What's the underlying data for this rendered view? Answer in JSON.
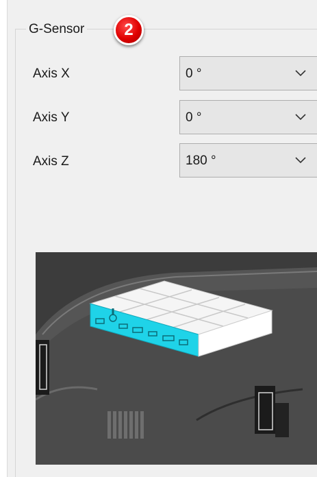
{
  "group": {
    "title": "G-Sensor",
    "badge": "2"
  },
  "axes": [
    {
      "label": "Axis X",
      "value": "0 °"
    },
    {
      "label": "Axis Y",
      "value": "0 °"
    },
    {
      "label": "Axis Z",
      "value": "180 °"
    }
  ],
  "colors": {
    "badge": "#e00000",
    "highlight": "#1fd3e8",
    "panel": "#f0f0f0"
  },
  "icons": {
    "dropdown": "chevron-down-icon",
    "badge": "numbered-callout"
  }
}
